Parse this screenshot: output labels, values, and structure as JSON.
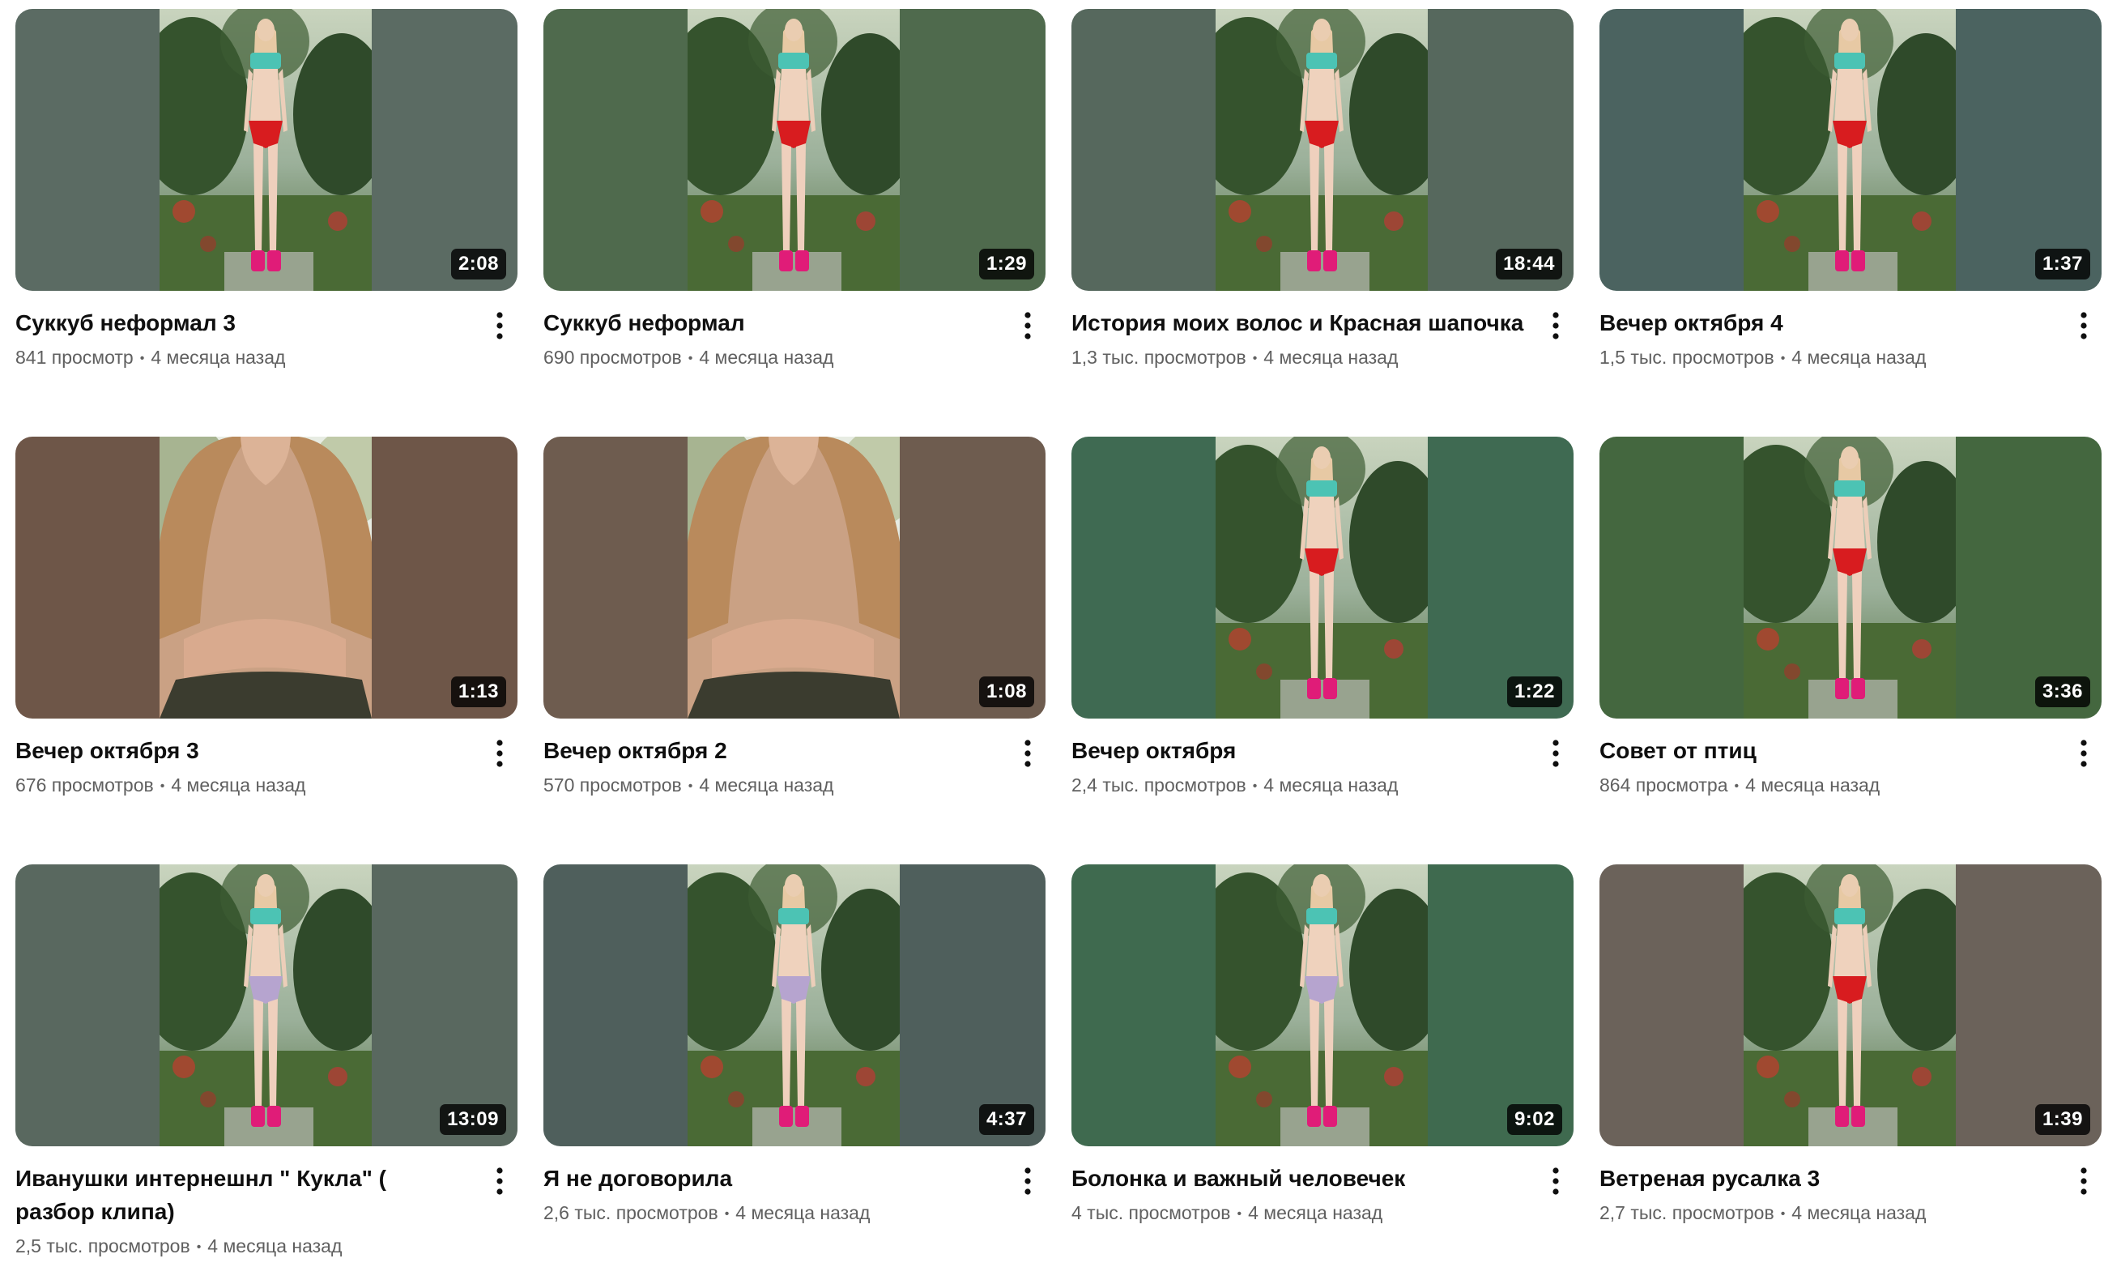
{
  "videos": [
    {
      "title": "Суккуб неформал 3",
      "views": "841 просмотр",
      "age": "4 месяца назад",
      "duration": "2:08",
      "bg": "#5b6b63",
      "top": "#c9d4be",
      "garment": "#d81c1f",
      "scene": "full"
    },
    {
      "title": "Суккуб неформал",
      "views": "690 просмотров",
      "age": "4 месяца назад",
      "duration": "1:29",
      "bg": "#4f6a4d",
      "top": "#c9d4be",
      "garment": "#d81c1f",
      "scene": "full"
    },
    {
      "title": "История моих волос и Красная шапочка",
      "views": "1,3 тыс. просмотров",
      "age": "4 месяца назад",
      "duration": "18:44",
      "bg": "#56685d",
      "top": "#d4dcc7",
      "garment": "#d81c1f",
      "scene": "full"
    },
    {
      "title": "Вечер октября 4",
      "views": "1,5 тыс. просмотров",
      "age": "4 месяца назад",
      "duration": "1:37",
      "bg": "#4b6360",
      "top": "#c6d1c4",
      "garment": "#d81c1f",
      "scene": "full"
    },
    {
      "title": "Вечер октября 3",
      "views": "676 просмотров",
      "age": "4 месяца назад",
      "duration": "1:13",
      "bg": "#6e5648",
      "top": "#e7ece3",
      "garment": "#3b3c2f",
      "scene": "close"
    },
    {
      "title": "Вечер октября 2",
      "views": "570 просмотров",
      "age": "4 месяца назад",
      "duration": "1:08",
      "bg": "#6e5c4f",
      "top": "#e7ece3",
      "garment": "#3b3c2f",
      "scene": "close"
    },
    {
      "title": "Вечер октября",
      "views": "2,4 тыс. просмотров",
      "age": "4 месяца назад",
      "duration": "1:22",
      "bg": "#3f6a52",
      "top": "#c9d3c6",
      "garment": "#d81c1f",
      "scene": "full"
    },
    {
      "title": "Совет от птиц",
      "views": "864 просмотра",
      "age": "4 месяца назад",
      "duration": "3:36",
      "bg": "#44673f",
      "top": "#cbd6c2",
      "garment": "#d81c1f",
      "scene": "full"
    },
    {
      "title": "Иванушки интернешнл \" Кукла\" ( разбор клипа)",
      "views": "2,5 тыс. просмотров",
      "age": "4 месяца назад",
      "duration": "13:09",
      "bg": "#59685f",
      "top": "#c4ceba",
      "garment": "#b6a4cf",
      "scene": "full"
    },
    {
      "title": "Я не договорила",
      "views": "2,6 тыс. просмотров",
      "age": "4 месяца назад",
      "duration": "4:37",
      "bg": "#4f5f5c",
      "top": "#cdd6c8",
      "garment": "#b6a4cf",
      "scene": "full"
    },
    {
      "title": "Болонка и важный человечек",
      "views": "4 тыс. просмотров",
      "age": "4 месяца назад",
      "duration": "9:02",
      "bg": "#3f6a4f",
      "top": "#c9d3c3",
      "garment": "#b6a4cf",
      "scene": "full"
    },
    {
      "title": "Ветреная русалка 3",
      "views": "2,7 тыс. просмотров",
      "age": "4 месяца назад",
      "duration": "1:39",
      "bg": "#6b625a",
      "top": "#d2d8cc",
      "garment": "#d81c1f",
      "scene": "full"
    }
  ]
}
